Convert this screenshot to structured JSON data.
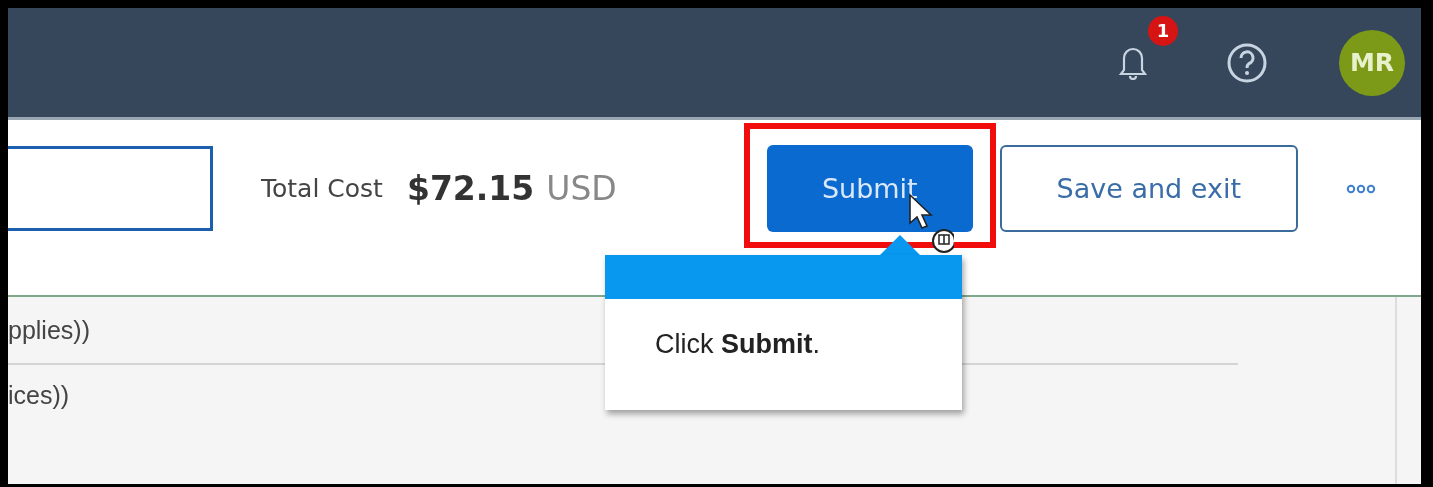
{
  "header": {
    "notifications": {
      "count": "1"
    },
    "avatar": {
      "initials": "MR"
    }
  },
  "toolbar": {
    "total_cost": {
      "label": "Total Cost",
      "amount": "$72.15",
      "currency": "USD"
    },
    "buttons": [
      {
        "label": "Submit",
        "kind": "primary"
      },
      {
        "label": "Save and exit",
        "kind": "secondary"
      }
    ]
  },
  "rows": [
    "pplies))",
    "ices))"
  ],
  "tooltip": {
    "text": "Click **Submit**."
  }
}
